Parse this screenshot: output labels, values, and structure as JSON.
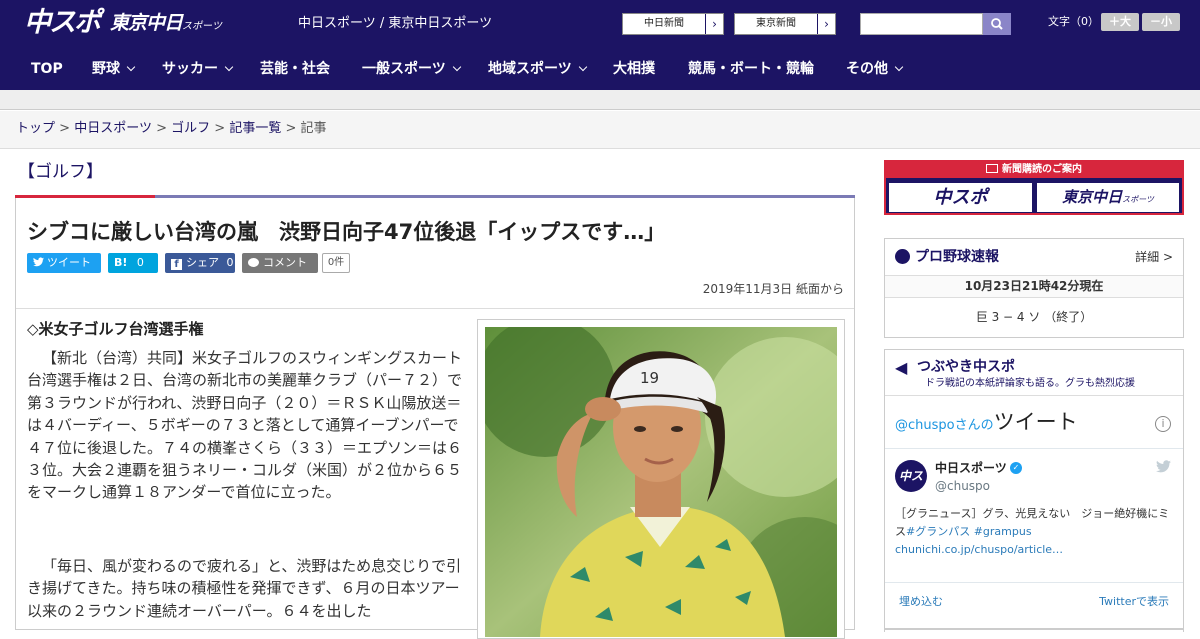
{
  "header": {
    "logo_chuspo": "中スポ",
    "logo_tokyo": "東京中日",
    "logo_tokyo_sub": "スポーツ",
    "site_title": "中日スポーツ / 東京中日スポーツ",
    "ext_links": [
      {
        "label": "中日新聞",
        "arrow": "›"
      },
      {
        "label": "東京新聞",
        "arrow": "›"
      }
    ],
    "search": {
      "placeholder": "",
      "icon": "search-icon"
    },
    "font_size": {
      "label": "文字（0）",
      "increase": "＋大",
      "decrease": "－小"
    }
  },
  "nav": {
    "items": [
      {
        "label": "TOP",
        "dropdown": false
      },
      {
        "label": "野球",
        "dropdown": true
      },
      {
        "label": "サッカー",
        "dropdown": true
      },
      {
        "label": "芸能・社会",
        "dropdown": false
      },
      {
        "label": "一般スポーツ",
        "dropdown": true
      },
      {
        "label": "地域スポーツ",
        "dropdown": true
      },
      {
        "label": "大相撲",
        "dropdown": false
      },
      {
        "label": "競馬・ボート・競輪",
        "dropdown": false
      },
      {
        "label": "その他",
        "dropdown": true
      }
    ]
  },
  "breadcrumb": {
    "items": [
      "トップ",
      "中日スポーツ",
      "ゴルフ",
      "記事一覧"
    ],
    "separator": ">",
    "current": "記事"
  },
  "section": {
    "title": "【ゴルフ】"
  },
  "article": {
    "headline": "シブコに厳しい台湾の嵐　渋野日向子47位後退「イップスです…」",
    "share": {
      "tweet": "ツイート",
      "hatena": "B!",
      "hatena_count": "0",
      "facebook": "シェア",
      "facebook_count": "0",
      "comment": "コメント",
      "comment_count": "0件"
    },
    "date": "2019年11月3日 紙面から",
    "subhead": "◇米女子ゴルフ台湾選手権",
    "paragraphs": [
      "【新北（台湾）共同】米女子ゴルフのスウィンギングスカート台湾選手権は２日、台湾の新北市の美麗華クラブ（パー７２）で第３ラウンドが行われ、渋野日向子（２０）＝ＲＳＫ山陽放送＝は４バーディー、５ボギーの７３と落として通算イーブンパーで４７位に後退した。７４の横峯さくら（３３）＝エプソン＝は６３位。大会２連覇を狙うネリー・コルダ（米国）が２位から６５をマークし通算１８アンダーで首位に立った。",
      "「毎日、風が変わるので疲れる」と、渋野はため息交じりで引き揚げてきた。持ち味の積極性を発揮できず、６月の日本ツアー以来の２ラウンド連続オーバーパー。６４を出した"
    ]
  },
  "sidebar": {
    "promo": {
      "head": "新聞購読のご案内",
      "logo1": "中スポ",
      "logo2": "東京中日",
      "logo2_sub": "スポーツ"
    },
    "baseball": {
      "title": "プロ野球速報",
      "detail": "詳細 >",
      "time": "10月23日21時42分現在",
      "score": "巨 3 − 4 ソ （終了）"
    },
    "tweets": {
      "title": "つぶやき中スポ",
      "subtitle": "ドラ戦記の本紙評論家も語る。グラも熱烈応援",
      "header_handle": "@chuspo",
      "header_san": "さんの",
      "header_word": "ツイート",
      "info": "i",
      "avatar": "中スポ",
      "name": "中日スポーツ",
      "handle": "@chuspo",
      "text_plain": "［グラニュース］グラ、光見えない　ジョー絶好機にミス",
      "text_tags": "#グランパス #grampus",
      "text_link": "chunichi.co.jp/chuspo/article…",
      "embed": "埋め込む",
      "view": "Twitterで表示"
    }
  },
  "colors": {
    "brand": "#1c1464",
    "accent": "#d7263d",
    "twitter": "#1da1f2",
    "hatena": "#00a4de",
    "facebook": "#3b5998",
    "comment": "#777777"
  }
}
